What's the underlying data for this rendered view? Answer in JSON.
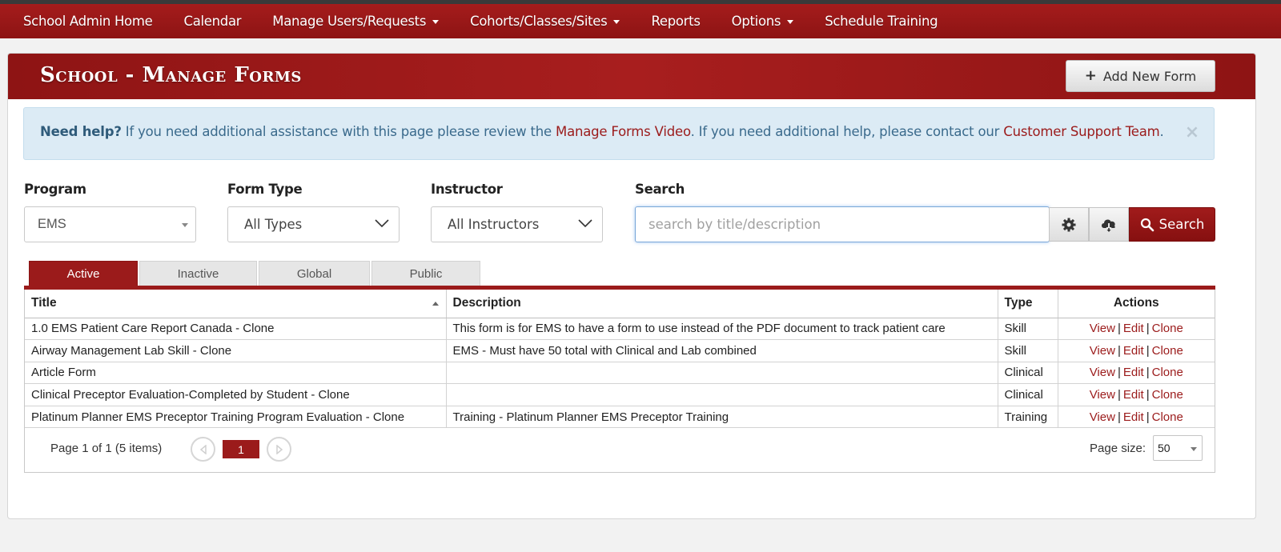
{
  "nav": {
    "items": [
      {
        "label": "School Admin Home",
        "dropdown": false
      },
      {
        "label": "Calendar",
        "dropdown": false
      },
      {
        "label": "Manage Users/Requests",
        "dropdown": true
      },
      {
        "label": "Cohorts/Classes/Sites",
        "dropdown": true
      },
      {
        "label": "Reports",
        "dropdown": false
      },
      {
        "label": "Options",
        "dropdown": true
      },
      {
        "label": "Schedule Training",
        "dropdown": false
      }
    ]
  },
  "header": {
    "title": "School - Manage Forms",
    "add_button_label": "Add New Form"
  },
  "help": {
    "lead": "Need help?",
    "text1": " If you need additional assistance with this page please review the ",
    "video_link": "Manage Forms Video",
    "text2": ". If you need additional help, please contact our ",
    "support_link": "Customer Support Team",
    "text3": ".",
    "close": "×"
  },
  "filters": {
    "program_label": "Program",
    "program_value": "EMS",
    "form_type_label": "Form Type",
    "form_type_value": "All Types",
    "instructor_label": "Instructor",
    "instructor_value": "All Instructors",
    "search_label": "Search",
    "search_placeholder": "search by title/description",
    "search_value": "",
    "search_button_label": "Search"
  },
  "tabs": [
    "Active",
    "Inactive",
    "Global",
    "Public"
  ],
  "active_tab": "Active",
  "table": {
    "columns": [
      "Title",
      "Description",
      "Type",
      "Actions"
    ],
    "rows": [
      {
        "title": "1.0 EMS Patient Care Report Canada - Clone",
        "description": "This form is for EMS to have a form to use instead of the PDF document to track patient care",
        "type": "Skill"
      },
      {
        "title": "Airway Management Lab Skill - Clone",
        "description": "EMS - Must have 50 total with Clinical and Lab combined",
        "type": "Skill"
      },
      {
        "title": "Article Form",
        "description": "",
        "type": "Clinical"
      },
      {
        "title": "Clinical Preceptor Evaluation-Completed by Student - Clone",
        "description": "",
        "type": "Clinical"
      },
      {
        "title": "Platinum Planner EMS Preceptor Training Program Evaluation - Clone",
        "description": "Training - Platinum Planner EMS Preceptor Training",
        "type": "Training"
      }
    ],
    "actions": {
      "view": "View",
      "edit": "Edit",
      "clone": "Clone",
      "separator": "|"
    }
  },
  "pager": {
    "info": "Page 1 of 1 (5 items)",
    "current_page": "1",
    "page_size_label": "Page size:",
    "page_size": "50"
  },
  "colors": {
    "brand": "#9b1b1b",
    "alert_bg": "#dcebf5"
  }
}
